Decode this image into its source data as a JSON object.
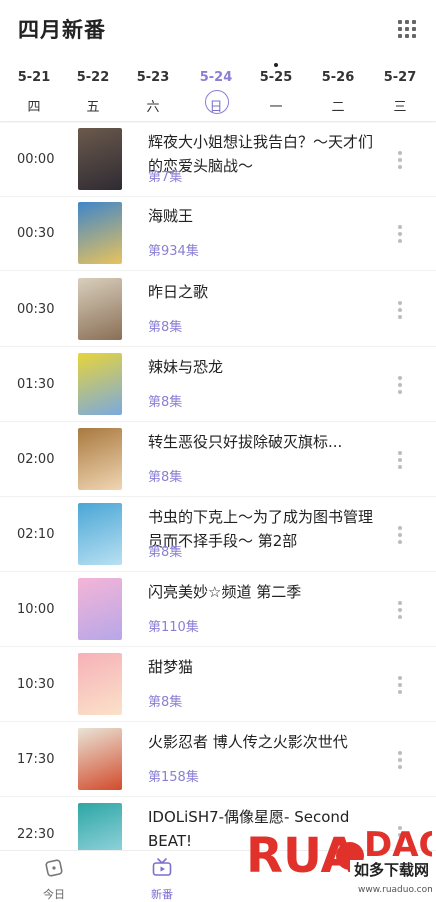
{
  "header": {
    "title": "四月新番",
    "grid_icon": "grid-icon"
  },
  "dates": [
    {
      "date": "5-21",
      "weekday": "四"
    },
    {
      "date": "5-22",
      "weekday": "五"
    },
    {
      "date": "5-23",
      "weekday": "六"
    },
    {
      "date": "5-24",
      "weekday": "日",
      "active": true
    },
    {
      "date": "5-25",
      "weekday": "一",
      "marker": true
    },
    {
      "date": "5-26",
      "weekday": "二"
    },
    {
      "date": "5-27",
      "weekday": "三"
    }
  ],
  "schedule": [
    {
      "time": "00:00",
      "title": "辉夜大小姐想让我告白？～天才们的恋爱头脑战～",
      "episode": "第7集",
      "cover": [
        "#6b5a4c",
        "#2f2a33"
      ]
    },
    {
      "time": "00:30",
      "title": "海贼王",
      "episode": "第934集",
      "cover": [
        "#3f86c9",
        "#e9c25d"
      ]
    },
    {
      "time": "00:30",
      "title": "昨日之歌",
      "episode": "第8集",
      "cover": [
        "#d9cfbd",
        "#8a6f56"
      ]
    },
    {
      "time": "01:30",
      "title": "辣妹与恐龙",
      "episode": "第8集",
      "cover": [
        "#e7d43b",
        "#7aa9df"
      ]
    },
    {
      "time": "02:00",
      "title": "转生恶役只好拔除破灭旗标...",
      "episode": "第8集",
      "cover": [
        "#a9793f",
        "#f0d6b3"
      ]
    },
    {
      "time": "02:10",
      "title": "书虫的下克上～为了成为图书管理员而不择手段～ 第2部",
      "episode": "第8集",
      "cover": [
        "#4aa6d6",
        "#b9e0f2"
      ]
    },
    {
      "time": "10:00",
      "title": "闪亮美妙☆频道 第二季",
      "episode": "第110集",
      "cover": [
        "#f4b5d7",
        "#b7a7e8"
      ]
    },
    {
      "time": "10:30",
      "title": "甜梦猫",
      "episode": "第8集",
      "cover": [
        "#f6b1b8",
        "#fbe1c8"
      ]
    },
    {
      "time": "17:30",
      "title": "火影忍者 博人传之火影次世代",
      "episode": "第158集",
      "cover": [
        "#e9e4d7",
        "#d24b2c"
      ]
    },
    {
      "time": "22:30",
      "title": "IDOLiSH7-偶像星愿- Second BEAT!",
      "episode": "",
      "cover": [
        "#2da6a4",
        "#a4dbe6"
      ]
    }
  ],
  "tabs": [
    {
      "label": "今日",
      "icon": "dice-icon"
    },
    {
      "label": "新番",
      "icon": "tv-icon",
      "active": true
    }
  ],
  "watermark": {
    "brand": "RUADAO",
    "sub": "如多下载网",
    "url": "www.ruaduo.com"
  },
  "colors": {
    "accent": "#8a7fd4",
    "watermark_red": "#e0322b"
  }
}
